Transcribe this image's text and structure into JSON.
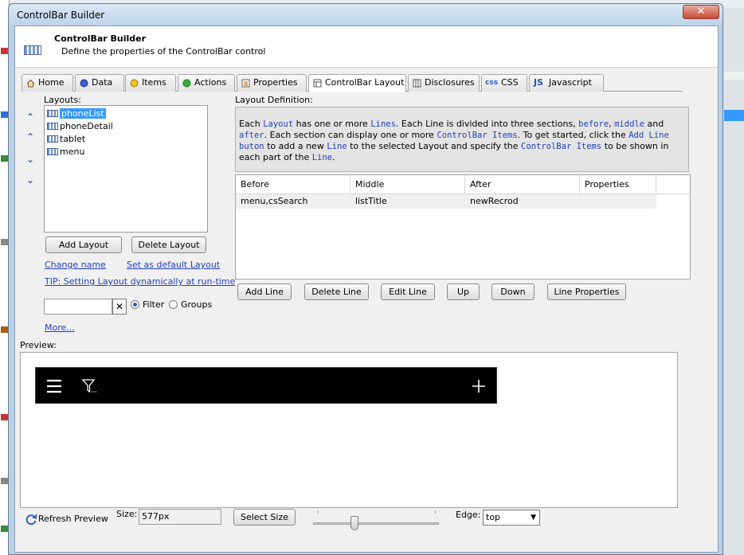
{
  "window": {
    "title": "ControlBar Builder",
    "close_icon": "close-icon"
  },
  "header": {
    "title": "ControlBar Builder",
    "subtitle": "Define the properties of the ControlBar control",
    "icon": "controlbar-icon"
  },
  "tabs": [
    {
      "label": "Home",
      "icon": "home-icon"
    },
    {
      "label": "Data",
      "icon": "data-icon"
    },
    {
      "label": "Items",
      "icon": "items-icon"
    },
    {
      "label": "Actions",
      "icon": "actions-icon"
    },
    {
      "label": "Properties",
      "icon": "properties-icon"
    },
    {
      "label": "ControlBar Layout",
      "icon": "layout-icon"
    },
    {
      "label": "Disclosures",
      "icon": "disclosures-icon"
    },
    {
      "label": "CSS",
      "icon": "css-icon"
    },
    {
      "label": "Javascript",
      "icon": "javascript-icon"
    }
  ],
  "active_tab": "ControlBar Layout",
  "layouts": {
    "label": "Layouts:",
    "items": [
      "phoneList",
      "phoneDetail",
      "tablet",
      "menu"
    ],
    "selected": "phoneList",
    "add_button": "Add Layout",
    "delete_button": "Delete Layout",
    "change_name_link": "Change name",
    "set_default_link": "Set as default Layout",
    "tip_link": "TIP: Setting Layout dynamically at run-time",
    "filter_value": "",
    "filter_label": "Filter",
    "groups_label": "Groups",
    "more_link": "More..."
  },
  "definition": {
    "label": "Layout Definition:",
    "info": {
      "p1": "Each ",
      "k1": "Layout",
      "p2": " has one or more ",
      "k2": "Lines",
      "p3": ". Each Line is divided into three sections, ",
      "k3": "before",
      "p4": ", ",
      "k4": "middle",
      "p5": " and ",
      "k5": "after",
      "p6": ". Each section can display one or more ",
      "k6": "ControlBar Items",
      "p7": ". To get started, click the ",
      "k7": "Add Line buton",
      "p8": " to add a new ",
      "k8": "Line",
      "p9": " to the selected Layout and specify the ",
      "k9": "ControlBar Items",
      "p10": " to be shown in each part of the ",
      "k10": "Line",
      "p11": "."
    },
    "columns": [
      "Before",
      "Middle",
      "After",
      "Properties"
    ],
    "rows": [
      {
        "before": "menu,csSearch",
        "middle": "listTitle",
        "after": "newRecrod",
        "properties": ""
      }
    ],
    "buttons": {
      "add_line": "Add Line",
      "delete_line": "Delete Line",
      "edit_line": "Edit Line",
      "up": "Up",
      "down": "Down",
      "line_properties": "Line Properties"
    }
  },
  "preview": {
    "label": "Preview:",
    "refresh_label": "Refresh Preview",
    "size_label": "Size:",
    "size_value": "577px",
    "select_size": "Select Size",
    "edge_label": "Edge:",
    "edge_value": "top",
    "slider_level": 0.33
  }
}
